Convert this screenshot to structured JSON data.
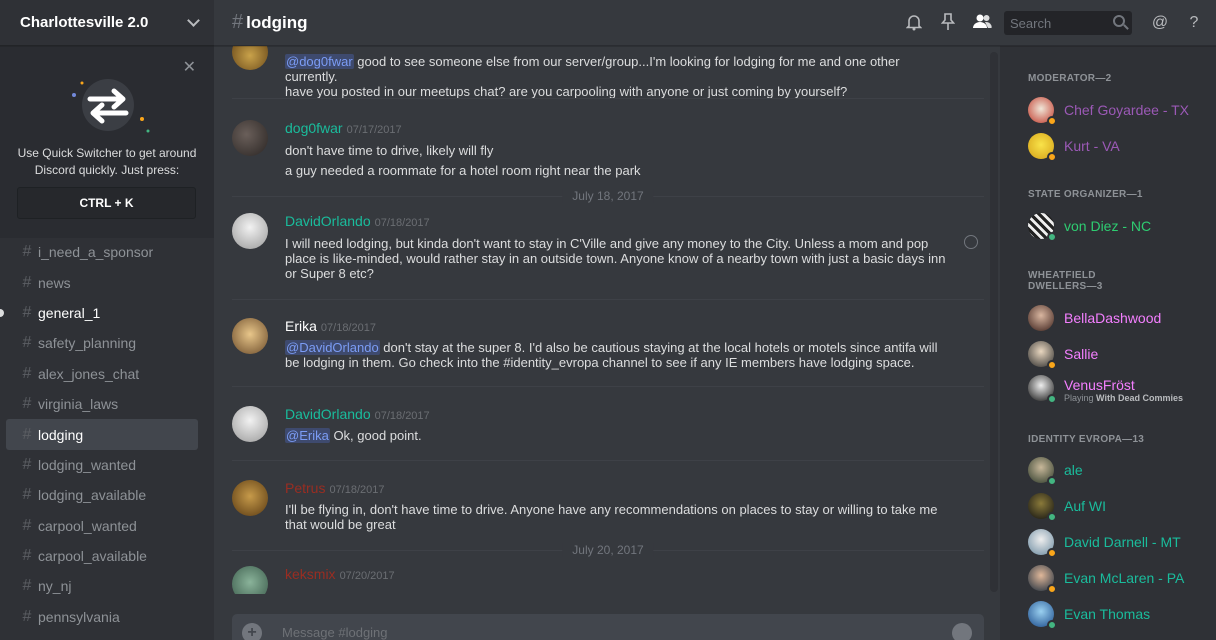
{
  "server": {
    "name": "Charlottesville 2.0"
  },
  "switcher": {
    "text": "Use Quick Switcher to get around Discord quickly. Just press:",
    "keys": "CTRL + K"
  },
  "channels": [
    {
      "name": "i_need_a_sponsor"
    },
    {
      "name": "news"
    },
    {
      "name": "general_1"
    },
    {
      "name": "safety_planning"
    },
    {
      "name": "alex_jones_chat"
    },
    {
      "name": "virginia_laws"
    },
    {
      "name": "lodging"
    },
    {
      "name": "lodging_wanted"
    },
    {
      "name": "lodging_available"
    },
    {
      "name": "carpool_wanted"
    },
    {
      "name": "carpool_available"
    },
    {
      "name": "ny_nj"
    },
    {
      "name": "pennsylvania"
    }
  ],
  "header": {
    "channel": "lodging",
    "search_placeholder": "Search"
  },
  "messages": [
    {
      "mention": "@dog0fwar",
      "line1": " good to see someone else from our server/group...I'm looking for lodging for me and one other currently.",
      "line2": "have you posted in our meetups chat? are you carpooling with anyone or just coming by yourself?"
    },
    {
      "author": "dog0fwar",
      "timestamp": "07/17/2017",
      "line1": "don't have time to drive, likely will fly",
      "line2": "a guy needed a roommate for a hotel room right near the park"
    },
    {
      "date": "July 18, 2017"
    },
    {
      "author": "DavidOrlando",
      "timestamp": "07/18/2017",
      "text": "I will need lodging, but kinda don't want to stay in C'Ville and give any money to the City. Unless a mom and pop place is like-minded, would rather stay in an outside town. Anyone know of a nearby town with just a basic days inn or Super 8 etc?"
    },
    {
      "author": "Erika",
      "timestamp": "07/18/2017",
      "mention": "@DavidOrlando",
      "text": " don't stay at the super 8. I'd also be cautious staying at the local hotels or motels since antifa will be lodging in them. Go check into the #identity_evropa channel to see if any IE members have lodging space."
    },
    {
      "author": "DavidOrlando",
      "timestamp": "07/18/2017",
      "mention": "@Erika",
      "text": " Ok, good point."
    },
    {
      "author": "Petrus",
      "timestamp": "07/18/2017",
      "text": "I'll be flying in, don't have time to drive. Anyone have any recommendations on places to stay or willing to take me that would be great"
    },
    {
      "date": "July 20, 2017"
    },
    {
      "author": "keksmix",
      "timestamp": "07/20/2017"
    }
  ],
  "composer": {
    "placeholder": "Message #lodging"
  },
  "members": {
    "groups": [
      {
        "title": "MODERATOR—2"
      },
      {
        "title": "STATE ORGANIZER—1"
      },
      {
        "title": "WHEATFIELD DWELLERS—3"
      },
      {
        "title": "IDENTITY EVROPA—13"
      }
    ],
    "list": [
      {
        "name": "Chef Goyardee - TX",
        "color": "#9b59b6"
      },
      {
        "name": "Kurt - VA",
        "color": "#9b59b6"
      },
      {
        "name": "von Diez - NC",
        "color": "#2ecc71"
      },
      {
        "name": "BellaDashwood",
        "color": "#f47fff"
      },
      {
        "name": "Sallie",
        "color": "#f47fff"
      },
      {
        "name": "VenusFröst",
        "color": "#f47fff",
        "activity_prefix": "Playing ",
        "activity": "With Dead Commies"
      },
      {
        "name": "ale",
        "color": "#1abc9c"
      },
      {
        "name": "Auf WI",
        "color": "#1abc9c"
      },
      {
        "name": "David Darnell - MT",
        "color": "#1abc9c"
      },
      {
        "name": "Evan McLaren - PA",
        "color": "#1abc9c"
      },
      {
        "name": "Evan Thomas",
        "color": "#1abc9c"
      }
    ]
  },
  "colors": {
    "author_david": "#1abc9c",
    "author_dog": "#1abc9c",
    "author_petrus": "#992d22",
    "author_keksmix": "#992d22",
    "status_online": "#43b581",
    "status_idle": "#faa61a"
  }
}
